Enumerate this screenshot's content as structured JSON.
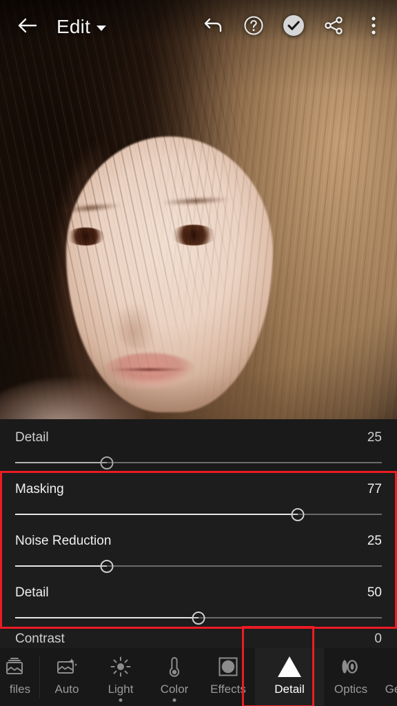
{
  "app": {
    "screen_title": "Edit"
  },
  "topbar": {
    "back_icon": "back-arrow-icon",
    "title": "Edit",
    "title_caret_icon": "chevron-down-icon",
    "undo_icon": "undo-icon",
    "help_icon": "help-circle-icon",
    "done_icon": "check-circle-icon",
    "share_icon": "share-icon",
    "more_icon": "overflow-menu-icon"
  },
  "panel": {
    "sliders": [
      {
        "label": "Detail",
        "value": "25",
        "percent": 25,
        "highlighted": false
      },
      {
        "label": "Masking",
        "value": "77",
        "percent": 77,
        "highlighted": true
      },
      {
        "label": "Noise Reduction",
        "value": "25",
        "percent": 25,
        "highlighted": true
      },
      {
        "label": "Detail",
        "value": "50",
        "percent": 50,
        "highlighted": true
      }
    ],
    "partial_slider": {
      "label": "Contrast",
      "value": "0"
    }
  },
  "annotations": {
    "highlight_color": "#ee1b24",
    "slider_group_box": "masking-noise-detail-group",
    "tab_box": "detail-tab"
  },
  "bottomnav": {
    "items": [
      {
        "label": "files",
        "icon": "profiles-icon",
        "active": false,
        "dot": false,
        "badge": null
      },
      {
        "label": "Auto",
        "icon": "auto-magic-icon",
        "active": false,
        "dot": false,
        "badge": null
      },
      {
        "label": "Light",
        "icon": "sun-icon",
        "active": false,
        "dot": true,
        "badge": null
      },
      {
        "label": "Color",
        "icon": "thermometer-icon",
        "active": false,
        "dot": true,
        "badge": null
      },
      {
        "label": "Effects",
        "icon": "vignette-icon",
        "active": false,
        "dot": false,
        "badge": null
      },
      {
        "label": "Detail",
        "icon": "triangle-icon",
        "active": true,
        "dot": false,
        "badge": null
      },
      {
        "label": "Optics",
        "icon": "lens-icon",
        "active": false,
        "dot": false,
        "badge": null
      },
      {
        "label": "Geometry",
        "icon": "perspective-grid-icon",
        "active": false,
        "dot": false,
        "badge": "star"
      }
    ]
  }
}
